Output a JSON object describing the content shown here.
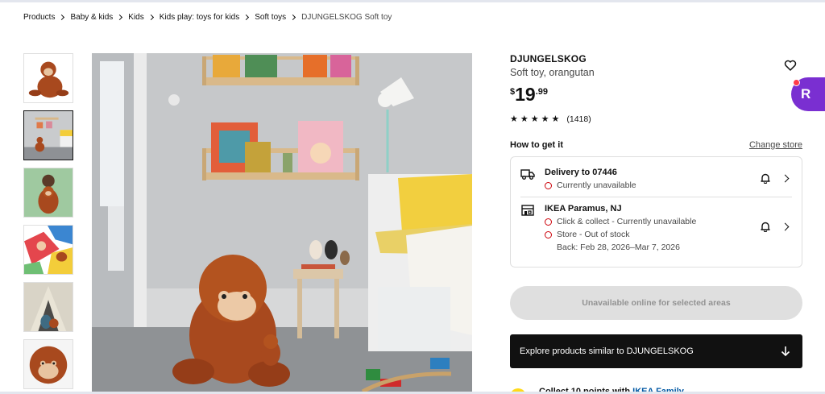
{
  "breadcrumb": {
    "items": [
      "Products",
      "Baby & kids",
      "Kids",
      "Kids play: toys for kids",
      "Soft toys"
    ],
    "current": "DJUNGELSKOG Soft toy"
  },
  "gallery": {
    "thumbnails": [
      "orangutan-toy",
      "kids-room-scene",
      "child-holding-toy",
      "colorful-bedding-scene",
      "child-in-tent-scene",
      "orangutan-face-closeup"
    ],
    "active_index": 1
  },
  "product": {
    "name": "DJUNGELSKOG",
    "description": "Soft toy, orangutan",
    "price_currency": "$",
    "price_integer": "19",
    "price_decimal": ".99",
    "rating_stars": 5,
    "review_count": "(1418)"
  },
  "availability": {
    "title": "How to get it",
    "change_store": "Change store",
    "delivery": {
      "title": "Delivery to 07446",
      "status": "Currently unavailable"
    },
    "store": {
      "title": "IKEA Paramus, NJ",
      "statuses": [
        "Click & collect - Currently unavailable",
        "Store - Out of stock"
      ],
      "back_date": "Back: Feb 28, 2026–Mar 7, 2026"
    }
  },
  "buttons": {
    "unavailable": "Unavailable online for selected areas",
    "explore": "Explore products similar to DJUNGELSKOG"
  },
  "family": {
    "text": "Collect 10 points with",
    "link": "IKEA Family"
  },
  "extension": {
    "letter": "R"
  },
  "colors": {
    "status_red": "#cc0008",
    "ext_purple": "#7a2fd1",
    "family_yellow": "#ffda1a",
    "link_blue": "#0058a3"
  }
}
